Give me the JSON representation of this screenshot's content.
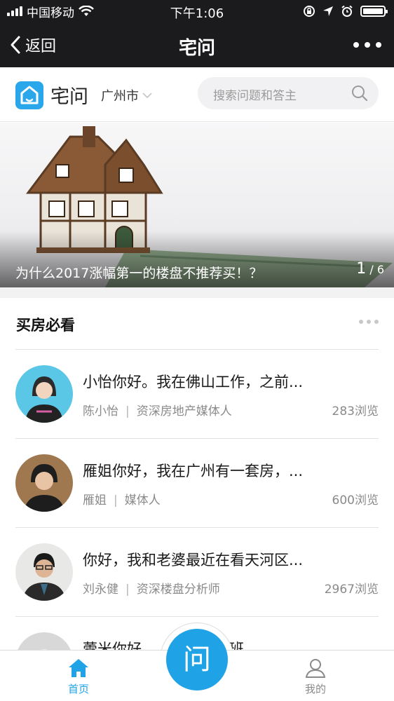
{
  "status_bar": {
    "carrier": "中国移动",
    "time": "下午1:06",
    "battery_level": 1.0
  },
  "nav": {
    "back_label": "返回",
    "title": "宅问"
  },
  "header": {
    "brand": "宅问",
    "city": "广州市",
    "search_placeholder": "搜索问题和答主"
  },
  "banner": {
    "caption": "为什么2017涨幅第一的楼盘不推荐买！？",
    "current_page": "1",
    "total_pages": "/ 6"
  },
  "section": {
    "title": "买房必看"
  },
  "questions": [
    {
      "text": "小怡你好。我在佛山工作，之前...",
      "author": "陈小怡",
      "role": "资深房地产媒体人",
      "views": "283浏览"
    },
    {
      "text": "雁姐你好，我在广州有一套房，...",
      "author": "雁姐",
      "role": "媒体人",
      "views": "600浏览"
    },
    {
      "text": "你好，我和老婆最近在看天河区...",
      "author": "刘永健",
      "role": "资深楼盘分析师",
      "views": "2967浏览"
    },
    {
      "text": "蕾米你好，...上了几年班",
      "author": "",
      "role": "",
      "views": ""
    }
  ],
  "tabbar": {
    "home_label": "首页",
    "ask_label": "问",
    "mine_label": "我的",
    "active_color": "#1fa3e6",
    "inactive_color": "#8a8a8a"
  }
}
